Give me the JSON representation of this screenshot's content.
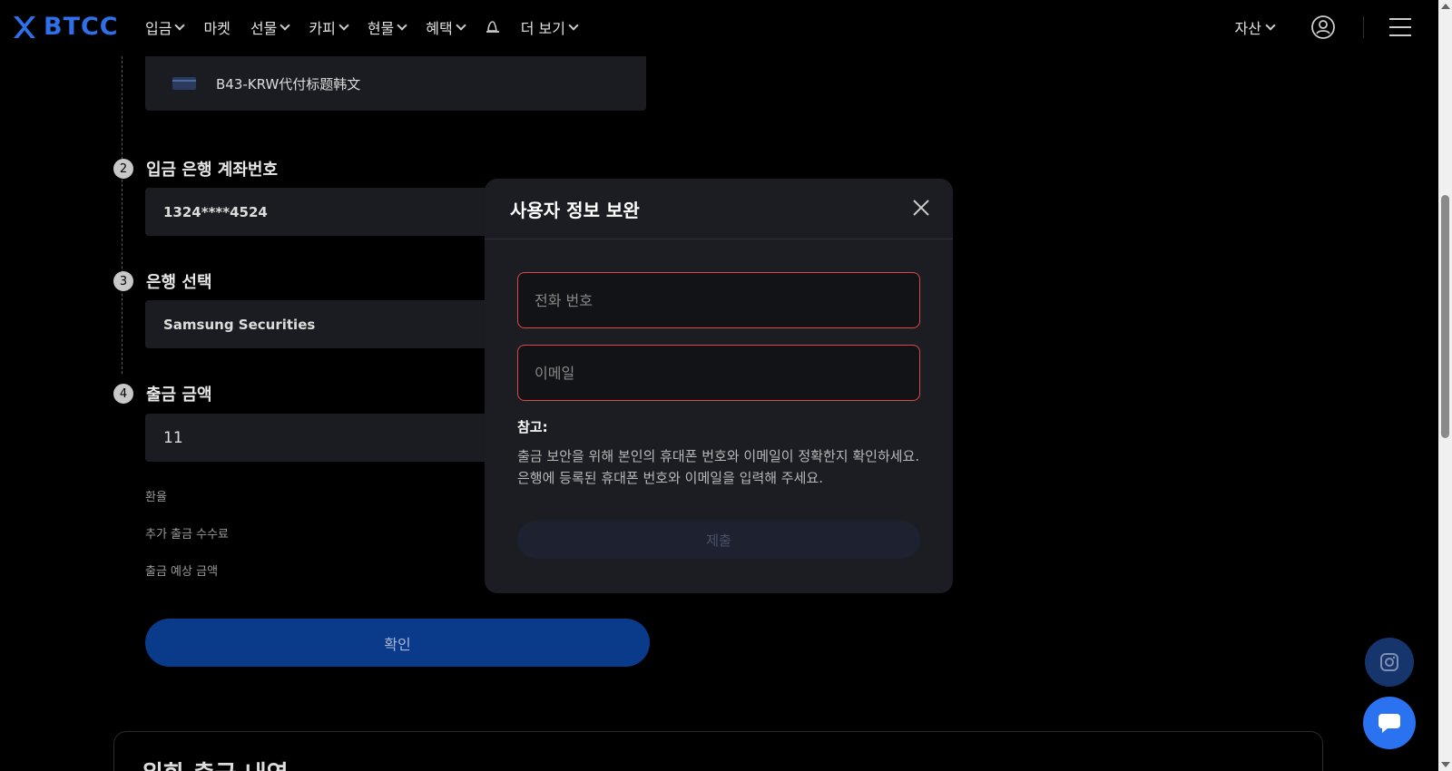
{
  "header": {
    "logo_text": "BTCC",
    "nav": [
      {
        "label": "입금",
        "dropdown": true
      },
      {
        "label": "마켓",
        "dropdown": false
      },
      {
        "label": "선물",
        "dropdown": true
      },
      {
        "label": "카피",
        "dropdown": true
      },
      {
        "label": "현물",
        "dropdown": true
      },
      {
        "label": "혜택",
        "dropdown": true
      },
      {
        "label": "",
        "icon": "hat-icon"
      },
      {
        "label": "더 보기",
        "dropdown": true
      }
    ],
    "asset_label": "자산"
  },
  "form": {
    "payment_method": "B43-KRW代付标题韩文",
    "step2": {
      "num": "2",
      "title": "입금 은행 계좌번호",
      "value": "1324****4524"
    },
    "step3": {
      "num": "3",
      "title": "은행 선택",
      "value": "Samsung Securities"
    },
    "step4": {
      "num": "4",
      "title": "출금 금액",
      "value": "11"
    },
    "labels": {
      "rate": "환율",
      "extra_fee": "추가 출금 수수료",
      "expected": "출금 예상 금액"
    },
    "confirm_label": "확인"
  },
  "history": {
    "title": "위화 출금 내역"
  },
  "modal": {
    "title": "사용자 정보 보완",
    "phone_placeholder": "전화 번호",
    "email_placeholder": "이메일",
    "note_title": "참고:",
    "note_text": "출금 보안을 위해 본인의 휴대폰 번호와 이메일이 정확한지 확인하세요. 은행에 등록된 휴대폰 번호와 이메일을 입력해 주세요.",
    "submit_label": "제출"
  },
  "colors": {
    "brand": "#2f6fe8",
    "error_border": "#e0444a",
    "confirm_bg": "#0a3a8a",
    "modal_bg": "#1b1d22"
  }
}
